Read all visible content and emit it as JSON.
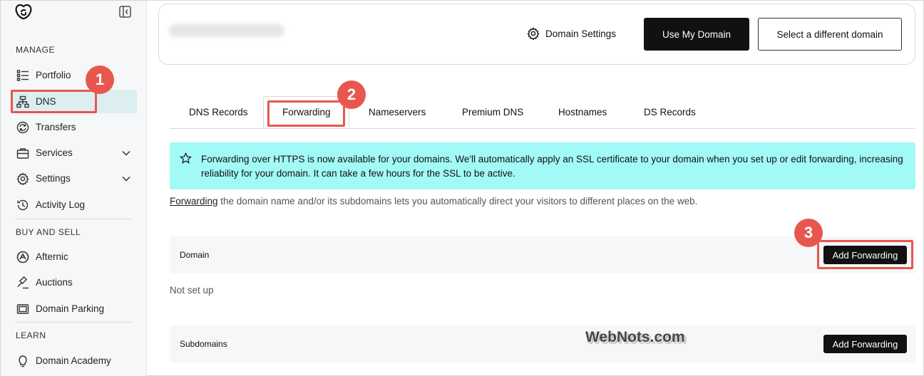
{
  "sidebar": {
    "sections": {
      "manage": "MANAGE",
      "buy_and_sell": "BUY AND SELL",
      "learn": "LEARN"
    },
    "items": [
      {
        "label": "Portfolio",
        "icon": "list-icon"
      },
      {
        "label": "DNS",
        "icon": "sitemap-icon",
        "active": true
      },
      {
        "label": "Transfers",
        "icon": "transfer-icon"
      },
      {
        "label": "Services",
        "icon": "briefcase-icon",
        "has_dropdown": true
      },
      {
        "label": "Settings",
        "icon": "gear-icon",
        "has_dropdown": true
      },
      {
        "label": "Activity Log",
        "icon": "history-icon"
      },
      {
        "label": "Afternic",
        "icon": "afternic-icon"
      },
      {
        "label": "Auctions",
        "icon": "gavel-icon"
      },
      {
        "label": "Domain Parking",
        "icon": "parking-icon"
      },
      {
        "label": "Domain Academy",
        "icon": "lightbulb-icon"
      }
    ]
  },
  "header": {
    "domain_settings": "Domain Settings",
    "use_my_domain": "Use My Domain",
    "select_different": "Select a different domain"
  },
  "tabs": [
    "DNS Records",
    "Forwarding",
    "Nameservers",
    "Premium DNS",
    "Hostnames",
    "DS Records"
  ],
  "active_tab": "Forwarding",
  "banner": {
    "text": "Forwarding over HTTPS is now available for your domains. We'll automatically apply an SSL certificate to your domain when you set up or edit forwarding, increasing reliability for your domain. It can take a few hours for the SSL to be active."
  },
  "description": {
    "link": "Forwarding",
    "rest": " the domain name and/or its subdomains lets you automatically direct your visitors to different places on the web."
  },
  "domain_row": {
    "label": "Domain",
    "button": "Add Forwarding",
    "status": "Not set up"
  },
  "subdomain_row": {
    "label": "Subdomains",
    "button": "Add Forwarding"
  },
  "annotations": [
    "1",
    "2",
    "3"
  ],
  "watermark": "WebNots.com",
  "colors": {
    "accent": "#e8574d",
    "banner": "#a2faf6",
    "active_nav": "#dceef0",
    "primary_button": "#111111"
  }
}
